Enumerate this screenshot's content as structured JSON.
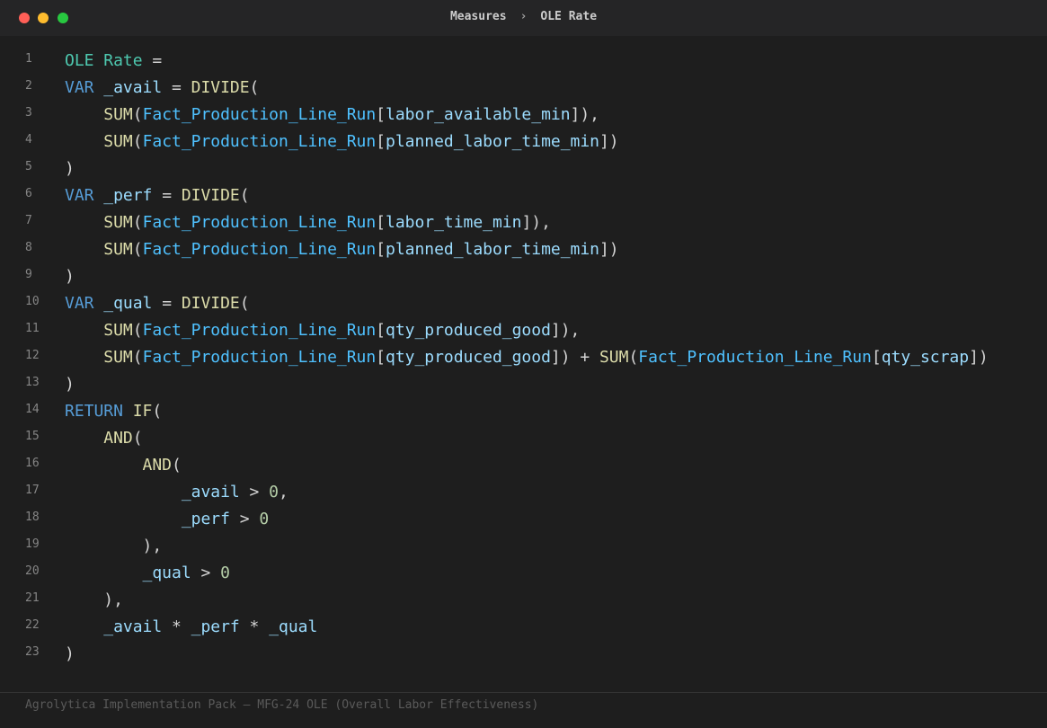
{
  "window": {
    "breadcrumb": {
      "parent": "Measures",
      "separator": "›",
      "current": "OLE Rate"
    },
    "controls": [
      "close",
      "minimize",
      "maximize"
    ]
  },
  "editor": {
    "lines": [
      {
        "n": "1",
        "indent": 0,
        "tokens": [
          {
            "t": "OLE Rate",
            "c": "measure"
          },
          {
            "t": " =",
            "c": "plain"
          }
        ]
      },
      {
        "n": "2",
        "indent": 0,
        "tokens": [
          {
            "t": "VAR",
            "c": "kw"
          },
          {
            "t": " ",
            "c": "plain"
          },
          {
            "t": "_avail",
            "c": "var"
          },
          {
            "t": " = ",
            "c": "plain"
          },
          {
            "t": "DIVIDE",
            "c": "fn"
          },
          {
            "t": "(",
            "c": "plain"
          }
        ]
      },
      {
        "n": "3",
        "indent": 4,
        "tokens": [
          {
            "t": "SUM",
            "c": "fn"
          },
          {
            "t": "(",
            "c": "plain"
          },
          {
            "t": "Fact_Production_Line_Run",
            "c": "tbl"
          },
          {
            "t": "[",
            "c": "plain"
          },
          {
            "t": "labor_available_min",
            "c": "var"
          },
          {
            "t": "]),",
            "c": "plain"
          }
        ]
      },
      {
        "n": "4",
        "indent": 4,
        "tokens": [
          {
            "t": "SUM",
            "c": "fn"
          },
          {
            "t": "(",
            "c": "plain"
          },
          {
            "t": "Fact_Production_Line_Run",
            "c": "tbl"
          },
          {
            "t": "[",
            "c": "plain"
          },
          {
            "t": "planned_labor_time_min",
            "c": "var"
          },
          {
            "t": "])",
            "c": "plain"
          }
        ]
      },
      {
        "n": "5",
        "indent": 0,
        "tokens": [
          {
            "t": ")",
            "c": "plain"
          }
        ]
      },
      {
        "n": "6",
        "indent": 0,
        "tokens": [
          {
            "t": "VAR",
            "c": "kw"
          },
          {
            "t": " ",
            "c": "plain"
          },
          {
            "t": "_perf",
            "c": "var"
          },
          {
            "t": " = ",
            "c": "plain"
          },
          {
            "t": "DIVIDE",
            "c": "fn"
          },
          {
            "t": "(",
            "c": "plain"
          }
        ]
      },
      {
        "n": "7",
        "indent": 4,
        "tokens": [
          {
            "t": "SUM",
            "c": "fn"
          },
          {
            "t": "(",
            "c": "plain"
          },
          {
            "t": "Fact_Production_Line_Run",
            "c": "tbl"
          },
          {
            "t": "[",
            "c": "plain"
          },
          {
            "t": "labor_time_min",
            "c": "var"
          },
          {
            "t": "]),",
            "c": "plain"
          }
        ]
      },
      {
        "n": "8",
        "indent": 4,
        "tokens": [
          {
            "t": "SUM",
            "c": "fn"
          },
          {
            "t": "(",
            "c": "plain"
          },
          {
            "t": "Fact_Production_Line_Run",
            "c": "tbl"
          },
          {
            "t": "[",
            "c": "plain"
          },
          {
            "t": "planned_labor_time_min",
            "c": "var"
          },
          {
            "t": "])",
            "c": "plain"
          }
        ]
      },
      {
        "n": "9",
        "indent": 0,
        "tokens": [
          {
            "t": ")",
            "c": "plain"
          }
        ]
      },
      {
        "n": "10",
        "indent": 0,
        "tokens": [
          {
            "t": "VAR",
            "c": "kw"
          },
          {
            "t": " ",
            "c": "plain"
          },
          {
            "t": "_qual",
            "c": "var"
          },
          {
            "t": " = ",
            "c": "plain"
          },
          {
            "t": "DIVIDE",
            "c": "fn"
          },
          {
            "t": "(",
            "c": "plain"
          }
        ]
      },
      {
        "n": "11",
        "indent": 4,
        "tokens": [
          {
            "t": "SUM",
            "c": "fn"
          },
          {
            "t": "(",
            "c": "plain"
          },
          {
            "t": "Fact_Production_Line_Run",
            "c": "tbl"
          },
          {
            "t": "[",
            "c": "plain"
          },
          {
            "t": "qty_produced_good",
            "c": "var"
          },
          {
            "t": "]),",
            "c": "plain"
          }
        ]
      },
      {
        "n": "12",
        "indent": 4,
        "tokens": [
          {
            "t": "SUM",
            "c": "fn"
          },
          {
            "t": "(",
            "c": "plain"
          },
          {
            "t": "Fact_Production_Line_Run",
            "c": "tbl"
          },
          {
            "t": "[",
            "c": "plain"
          },
          {
            "t": "qty_produced_good",
            "c": "var"
          },
          {
            "t": "]) + ",
            "c": "plain"
          },
          {
            "t": "SUM",
            "c": "fn"
          },
          {
            "t": "(",
            "c": "plain"
          },
          {
            "t": "Fact_Production_Line_Run",
            "c": "tbl"
          },
          {
            "t": "[",
            "c": "plain"
          },
          {
            "t": "qty_scrap",
            "c": "var"
          },
          {
            "t": "])",
            "c": "plain"
          }
        ]
      },
      {
        "n": "13",
        "indent": 0,
        "tokens": [
          {
            "t": ")",
            "c": "plain"
          }
        ]
      },
      {
        "n": "14",
        "indent": 0,
        "tokens": [
          {
            "t": "RETURN",
            "c": "kw"
          },
          {
            "t": " ",
            "c": "plain"
          },
          {
            "t": "IF",
            "c": "fn"
          },
          {
            "t": "(",
            "c": "plain"
          }
        ]
      },
      {
        "n": "15",
        "indent": 4,
        "tokens": [
          {
            "t": "AND",
            "c": "fn"
          },
          {
            "t": "(",
            "c": "plain"
          }
        ]
      },
      {
        "n": "16",
        "indent": 8,
        "tokens": [
          {
            "t": "AND",
            "c": "fn"
          },
          {
            "t": "(",
            "c": "plain"
          }
        ]
      },
      {
        "n": "17",
        "indent": 12,
        "tokens": [
          {
            "t": "_avail",
            "c": "var"
          },
          {
            "t": " > ",
            "c": "plain"
          },
          {
            "t": "0",
            "c": "num"
          },
          {
            "t": ",",
            "c": "plain"
          }
        ]
      },
      {
        "n": "18",
        "indent": 12,
        "tokens": [
          {
            "t": "_perf",
            "c": "var"
          },
          {
            "t": " > ",
            "c": "plain"
          },
          {
            "t": "0",
            "c": "num"
          }
        ]
      },
      {
        "n": "19",
        "indent": 8,
        "tokens": [
          {
            "t": "),",
            "c": "plain"
          }
        ]
      },
      {
        "n": "20",
        "indent": 8,
        "tokens": [
          {
            "t": "_qual",
            "c": "var"
          },
          {
            "t": " > ",
            "c": "plain"
          },
          {
            "t": "0",
            "c": "num"
          }
        ]
      },
      {
        "n": "21",
        "indent": 4,
        "tokens": [
          {
            "t": "),",
            "c": "plain"
          }
        ]
      },
      {
        "n": "22",
        "indent": 4,
        "tokens": [
          {
            "t": "_avail",
            "c": "var"
          },
          {
            "t": " * ",
            "c": "plain"
          },
          {
            "t": "_perf",
            "c": "var"
          },
          {
            "t": " * ",
            "c": "plain"
          },
          {
            "t": "_qual",
            "c": "var"
          }
        ]
      },
      {
        "n": "23",
        "indent": 0,
        "tokens": [
          {
            "t": ")",
            "c": "plain"
          }
        ]
      }
    ]
  },
  "footer": {
    "text": "Agrolytica Implementation Pack — MFG-24 OLE (Overall Labor Effectiveness)"
  },
  "colors": {
    "background": "#1e1e1e",
    "keyword": "#569cd6",
    "function": "#dcdcaa",
    "table": "#4fc1ff",
    "column": "#9cdcfe",
    "number": "#b5cea8",
    "measure": "#4ec9b0"
  }
}
